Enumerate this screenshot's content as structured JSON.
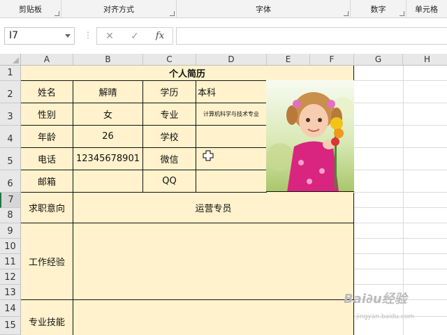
{
  "ribbon": {
    "groups": [
      "剪贴板",
      "对齐方式",
      "字体",
      "数字",
      "单元格"
    ]
  },
  "formula_bar": {
    "name_box": "I7",
    "dots": "⋮",
    "cancel": "✕",
    "enter": "✓",
    "fx": "fx",
    "content": ""
  },
  "grid": {
    "columns": [
      "A",
      "B",
      "C",
      "D",
      "E",
      "F",
      "G",
      "H"
    ],
    "rows": [
      "1",
      "2",
      "3",
      "4",
      "5",
      "6",
      "7",
      "8",
      "9",
      "10",
      "11",
      "12",
      "13",
      "14",
      "15"
    ]
  },
  "resume": {
    "title": "个人简历",
    "name_label": "姓名",
    "name_value": "解晴",
    "education_label": "学历",
    "education_value": "本科",
    "gender_label": "性别",
    "gender_value": "女",
    "major_label": "专业",
    "major_value": "计算机科学与技术专业",
    "age_label": "年龄",
    "age_value": "26",
    "school_label": "学校",
    "school_value": "",
    "phone_label": "电话",
    "phone_value": "12345678901",
    "wechat_label": "微信",
    "wechat_value": "",
    "email_label": "邮箱",
    "email_value": "",
    "qq_label": "QQ",
    "qq_value": "",
    "objective_label": "求职意向",
    "objective_value": "运营专员",
    "experience_label": "工作经验",
    "experience_value": "",
    "skills_label": "专业技能",
    "skills_value": ""
  },
  "watermark": {
    "logo": "Bai∂u经验",
    "url": "jingyan.baidu.com"
  }
}
